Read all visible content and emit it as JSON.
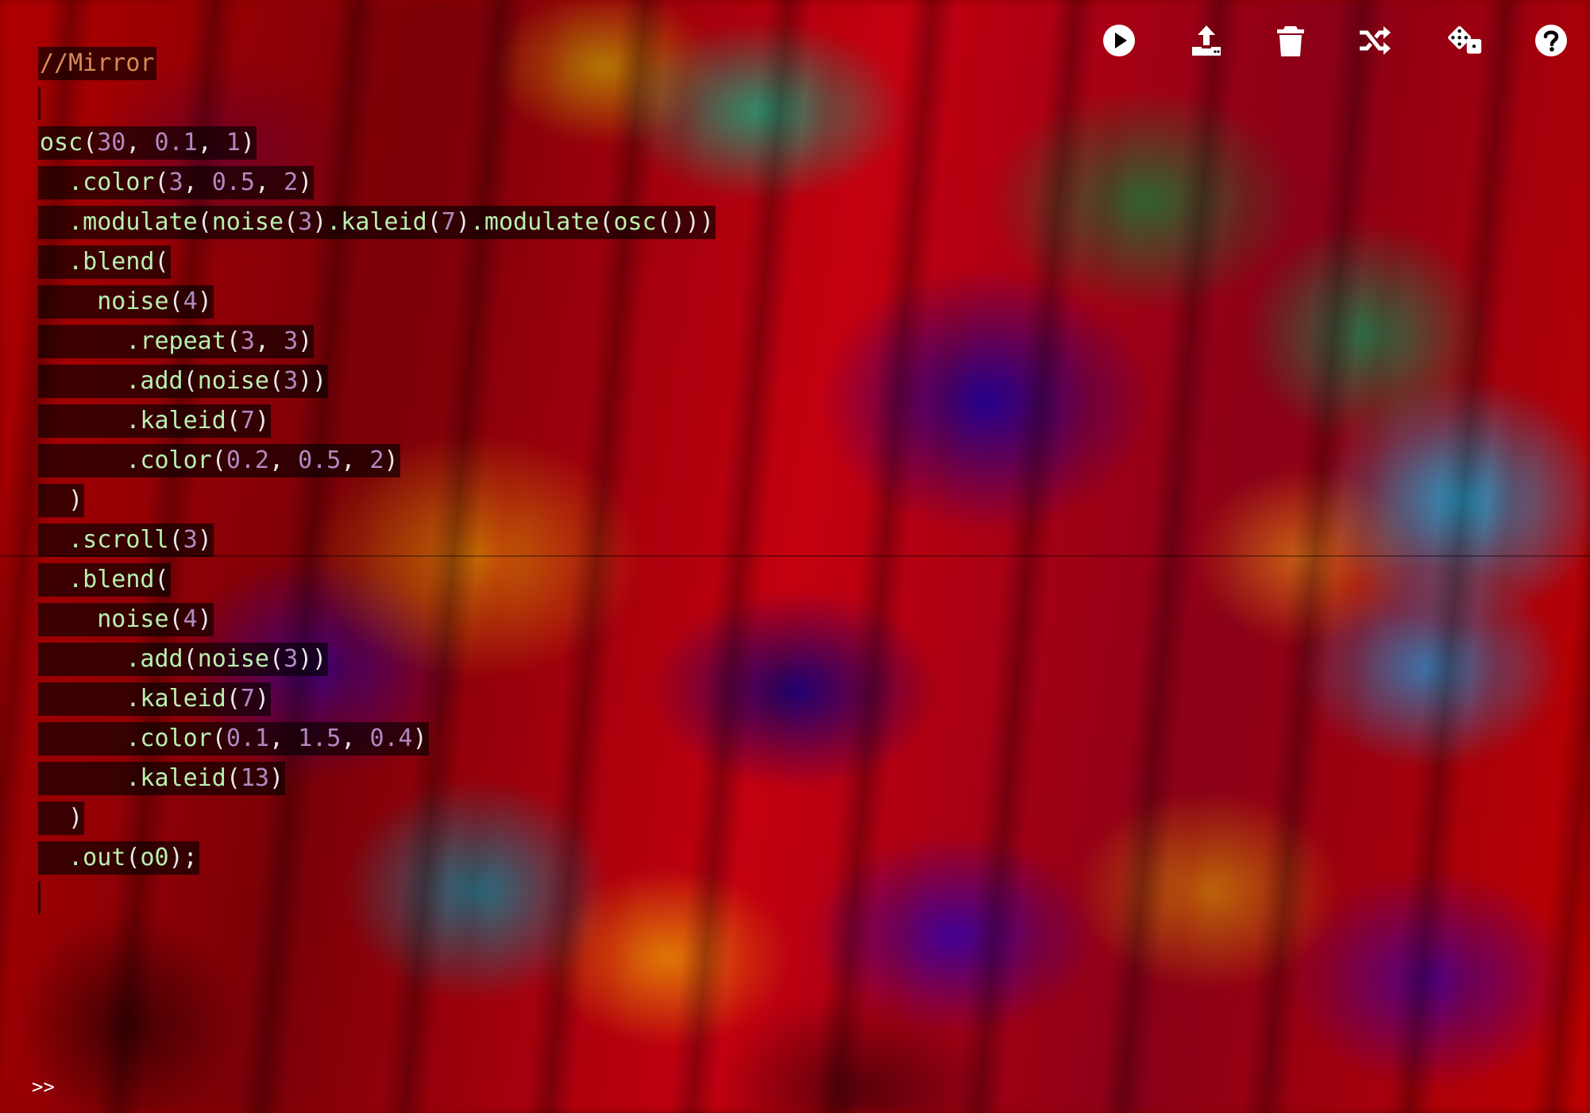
{
  "editor": {
    "lines": [
      {
        "indent": "",
        "tokens": [
          {
            "t": "comment",
            "v": "//Mirror"
          }
        ]
      },
      {
        "indent": "",
        "tokens": []
      },
      {
        "indent": "",
        "tokens": [
          {
            "t": "fn",
            "v": "osc"
          },
          {
            "t": "punct",
            "v": "("
          },
          {
            "t": "num",
            "v": "30"
          },
          {
            "t": "punct",
            "v": ", "
          },
          {
            "t": "num",
            "v": "0.1"
          },
          {
            "t": "punct",
            "v": ", "
          },
          {
            "t": "num",
            "v": "1"
          },
          {
            "t": "punct",
            "v": ")"
          }
        ]
      },
      {
        "indent": "  ",
        "tokens": [
          {
            "t": "fn",
            "v": ".color"
          },
          {
            "t": "punct",
            "v": "("
          },
          {
            "t": "num",
            "v": "3"
          },
          {
            "t": "punct",
            "v": ", "
          },
          {
            "t": "num",
            "v": "0.5"
          },
          {
            "t": "punct",
            "v": ", "
          },
          {
            "t": "num",
            "v": "2"
          },
          {
            "t": "punct",
            "v": ")"
          }
        ]
      },
      {
        "indent": "  ",
        "tokens": [
          {
            "t": "fn",
            "v": ".modulate"
          },
          {
            "t": "punct",
            "v": "("
          },
          {
            "t": "fn",
            "v": "noise"
          },
          {
            "t": "punct",
            "v": "("
          },
          {
            "t": "num",
            "v": "3"
          },
          {
            "t": "punct",
            "v": ")"
          },
          {
            "t": "fn",
            "v": ".kaleid"
          },
          {
            "t": "punct",
            "v": "("
          },
          {
            "t": "num",
            "v": "7"
          },
          {
            "t": "punct",
            "v": ")"
          },
          {
            "t": "fn",
            "v": ".modulate"
          },
          {
            "t": "punct",
            "v": "("
          },
          {
            "t": "fn",
            "v": "osc"
          },
          {
            "t": "punct",
            "v": "()))"
          }
        ]
      },
      {
        "indent": "  ",
        "tokens": [
          {
            "t": "fn",
            "v": ".blend"
          },
          {
            "t": "punct",
            "v": "("
          }
        ]
      },
      {
        "indent": "    ",
        "tokens": [
          {
            "t": "fn",
            "v": "noise"
          },
          {
            "t": "punct",
            "v": "("
          },
          {
            "t": "num",
            "v": "4"
          },
          {
            "t": "punct",
            "v": ")"
          }
        ]
      },
      {
        "indent": "      ",
        "tokens": [
          {
            "t": "fn",
            "v": ".repeat"
          },
          {
            "t": "punct",
            "v": "("
          },
          {
            "t": "num",
            "v": "3"
          },
          {
            "t": "punct",
            "v": ", "
          },
          {
            "t": "num",
            "v": "3"
          },
          {
            "t": "punct",
            "v": ")"
          }
        ]
      },
      {
        "indent": "      ",
        "tokens": [
          {
            "t": "fn",
            "v": ".add"
          },
          {
            "t": "punct",
            "v": "("
          },
          {
            "t": "fn",
            "v": "noise"
          },
          {
            "t": "punct",
            "v": "("
          },
          {
            "t": "num",
            "v": "3"
          },
          {
            "t": "punct",
            "v": "))"
          }
        ]
      },
      {
        "indent": "      ",
        "tokens": [
          {
            "t": "fn",
            "v": ".kaleid"
          },
          {
            "t": "punct",
            "v": "("
          },
          {
            "t": "num",
            "v": "7"
          },
          {
            "t": "punct",
            "v": ")"
          }
        ]
      },
      {
        "indent": "      ",
        "tokens": [
          {
            "t": "fn",
            "v": ".color"
          },
          {
            "t": "punct",
            "v": "("
          },
          {
            "t": "num",
            "v": "0.2"
          },
          {
            "t": "punct",
            "v": ", "
          },
          {
            "t": "num",
            "v": "0.5"
          },
          {
            "t": "punct",
            "v": ", "
          },
          {
            "t": "num",
            "v": "2"
          },
          {
            "t": "punct",
            "v": ")"
          }
        ]
      },
      {
        "indent": "  ",
        "tokens": [
          {
            "t": "punct",
            "v": ")"
          }
        ]
      },
      {
        "indent": "  ",
        "tokens": [
          {
            "t": "fn",
            "v": ".scroll"
          },
          {
            "t": "punct",
            "v": "("
          },
          {
            "t": "num",
            "v": "3"
          },
          {
            "t": "punct",
            "v": ")"
          }
        ]
      },
      {
        "indent": "  ",
        "tokens": [
          {
            "t": "fn",
            "v": ".blend"
          },
          {
            "t": "punct",
            "v": "("
          }
        ]
      },
      {
        "indent": "    ",
        "tokens": [
          {
            "t": "fn",
            "v": "noise"
          },
          {
            "t": "punct",
            "v": "("
          },
          {
            "t": "num",
            "v": "4"
          },
          {
            "t": "punct",
            "v": ")"
          }
        ]
      },
      {
        "indent": "      ",
        "tokens": [
          {
            "t": "fn",
            "v": ".add"
          },
          {
            "t": "punct",
            "v": "("
          },
          {
            "t": "fn",
            "v": "noise"
          },
          {
            "t": "punct",
            "v": "("
          },
          {
            "t": "num",
            "v": "3"
          },
          {
            "t": "punct",
            "v": "))"
          }
        ]
      },
      {
        "indent": "      ",
        "tokens": [
          {
            "t": "fn",
            "v": ".kaleid"
          },
          {
            "t": "punct",
            "v": "("
          },
          {
            "t": "num",
            "v": "7"
          },
          {
            "t": "punct",
            "v": ")"
          }
        ]
      },
      {
        "indent": "      ",
        "tokens": [
          {
            "t": "fn",
            "v": ".color"
          },
          {
            "t": "punct",
            "v": "("
          },
          {
            "t": "num",
            "v": "0.1"
          },
          {
            "t": "punct",
            "v": ", "
          },
          {
            "t": "num",
            "v": "1.5"
          },
          {
            "t": "punct",
            "v": ", "
          },
          {
            "t": "num",
            "v": "0.4"
          },
          {
            "t": "punct",
            "v": ")"
          }
        ]
      },
      {
        "indent": "      ",
        "tokens": [
          {
            "t": "fn",
            "v": ".kaleid"
          },
          {
            "t": "punct",
            "v": "("
          },
          {
            "t": "num",
            "v": "13"
          },
          {
            "t": "punct",
            "v": ")"
          }
        ]
      },
      {
        "indent": "  ",
        "tokens": [
          {
            "t": "punct",
            "v": ")"
          }
        ]
      },
      {
        "indent": "  ",
        "tokens": [
          {
            "t": "fn",
            "v": ".out"
          },
          {
            "t": "punct",
            "v": "("
          },
          {
            "t": "fn",
            "v": "o0"
          },
          {
            "t": "punct",
            "v": ");"
          }
        ]
      },
      {
        "indent": "",
        "tokens": []
      }
    ],
    "colors": {
      "comment": "#d88a55",
      "function": "#b9f0b0",
      "number": "#b08ac0",
      "punctuation": "#e8e8e8",
      "line_background": "rgba(0,0,0,0.62)"
    }
  },
  "toolbar": {
    "buttons": [
      {
        "name": "run-button",
        "icon": "play-circle-icon"
      },
      {
        "name": "upload-button",
        "icon": "upload-icon"
      },
      {
        "name": "clear-button",
        "icon": "trash-icon"
      },
      {
        "name": "shuffle-button",
        "icon": "shuffle-icon"
      },
      {
        "name": "random-button",
        "icon": "dice-icon"
      },
      {
        "name": "help-button",
        "icon": "question-circle-icon"
      }
    ]
  },
  "console": {
    "prompt": ">>"
  }
}
